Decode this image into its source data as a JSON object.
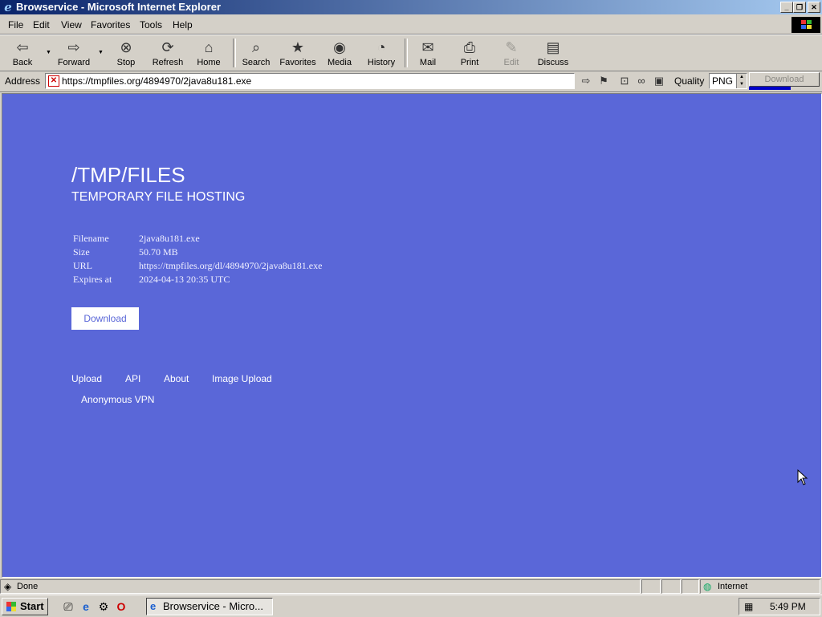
{
  "window": {
    "title": "Browservice - Microsoft Internet Explorer"
  },
  "menu": [
    "File",
    "Edit",
    "View",
    "Favorites",
    "Tools",
    "Help"
  ],
  "toolbar": {
    "back": "Back",
    "forward": "Forward",
    "stop": "Stop",
    "refresh": "Refresh",
    "home": "Home",
    "search": "Search",
    "favorites": "Favorites",
    "media": "Media",
    "history": "History",
    "mail": "Mail",
    "print": "Print",
    "edit": "Edit",
    "discuss": "Discuss"
  },
  "addressbar": {
    "label": "Address",
    "url": "https://tmpfiles.org/4894970/2java8u181.exe",
    "quality_label": "Quality",
    "quality_value": "PNG",
    "download_label": "Download",
    "download_progress": 0.6
  },
  "page": {
    "title": "/TMP/FILES",
    "subtitle": "TEMPORARY FILE HOSTING",
    "file_info": [
      {
        "key": "Filename",
        "value": "2java8u181.exe"
      },
      {
        "key": "Size",
        "value": "50.70 MB"
      },
      {
        "key": "URL",
        "value": "https://tmpfiles.org/dl/4894970/2java8u181.exe"
      },
      {
        "key": "Expires at",
        "value": "2024-04-13 20:35 UTC"
      }
    ],
    "download_button": "Download",
    "nav_links": [
      "Upload",
      "API",
      "About",
      "Image Upload"
    ],
    "vpn_link": "Anonymous VPN",
    "background_color": "#5a67d8"
  },
  "statusbar": {
    "status": "Done",
    "zone": "Internet"
  },
  "taskbar": {
    "start": "Start",
    "task": "Browservice - Micro...",
    "clock": "5:49 PM"
  }
}
